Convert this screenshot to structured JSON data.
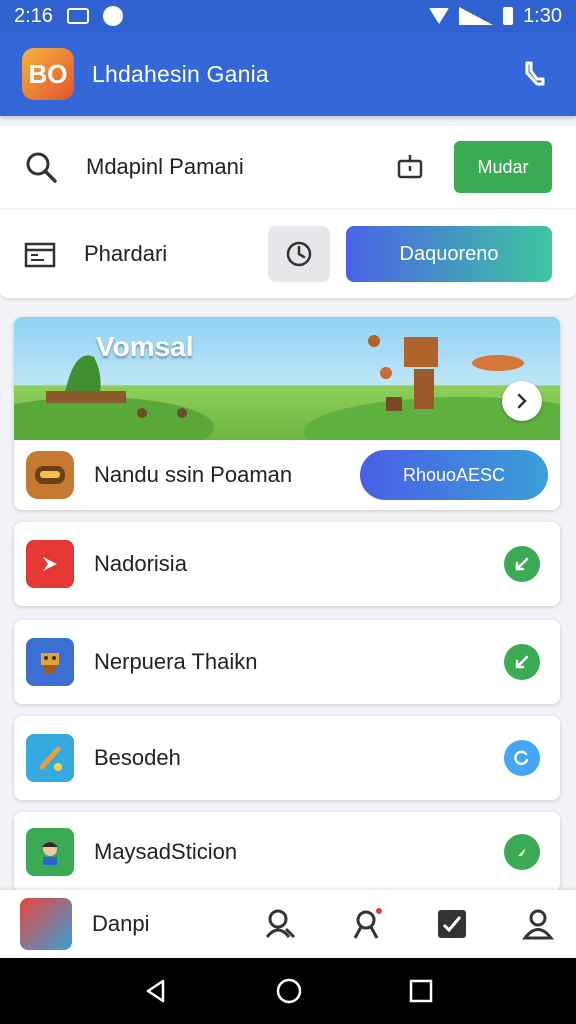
{
  "status_bar": {
    "time": "2:16",
    "clock": "1:30"
  },
  "app_bar": {
    "title": "Lhdahesin Gania",
    "logo_text": "BO"
  },
  "search_row": {
    "label": "Mdapinl Pamani",
    "button_label": "Mudar"
  },
  "second_row": {
    "label": "Phardari",
    "button_label": "Daquoreno"
  },
  "banner": {
    "title": "Vomsal",
    "row_label": "Nandu ssin Poaman",
    "button_label": "RhouoAESC"
  },
  "list": [
    {
      "label": "Nadorisia",
      "icon": "play-icon",
      "icon_color": "#e53935",
      "status_color": "#3aaa55"
    },
    {
      "label": "Nerpuera Thaikn",
      "icon": "game-icon",
      "icon_color": "#3b6fd1",
      "status_color": "#3aaa55"
    },
    {
      "label": "Besodeh",
      "icon": "tool-icon",
      "icon_color": "#36a9e1",
      "status_color": "#42a5f5"
    },
    {
      "label": "MaysadSticion",
      "icon": "character-icon",
      "icon_color": "#3aaa55",
      "status_color": "#3aaa55"
    }
  ],
  "bottom_nav": {
    "label": "Danpi"
  },
  "colors": {
    "primary": "#3468d8",
    "green": "#3aaa55"
  }
}
